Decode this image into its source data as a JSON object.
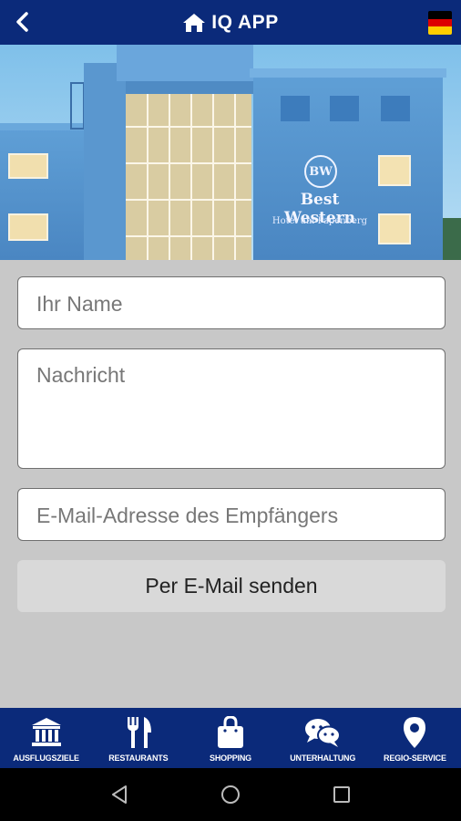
{
  "header": {
    "title": "IQ APP",
    "back_icon": "chevron-left-icon",
    "home_icon": "home-icon",
    "language_flag": "germany-flag-icon",
    "bar_color": "#0b2a7a"
  },
  "hero": {
    "brand_name": "Best Western",
    "brand_subtitle": "Hotel am Papenberg",
    "brand_badge": "BW"
  },
  "form": {
    "name_placeholder": "Ihr Name",
    "message_placeholder": "Nachricht",
    "email_placeholder": "E-Mail-Adresse des Empfängers",
    "send_label": "Per E-Mail senden"
  },
  "bottom_nav": {
    "items": [
      {
        "label": "AUSFLUGSZIELE",
        "icon": "museum-icon"
      },
      {
        "label": "RESTAURANTS",
        "icon": "cutlery-icon"
      },
      {
        "label": "SHOPPING",
        "icon": "shopping-bag-icon"
      },
      {
        "label": "UNTERHALTUNG",
        "icon": "chat-bubbles-icon"
      },
      {
        "label": "REGIO-SERVICE",
        "icon": "location-pin-icon"
      }
    ]
  },
  "system_nav": {
    "back_icon": "triangle-back-icon",
    "home_icon": "circle-home-icon",
    "recents_icon": "square-recents-icon"
  }
}
